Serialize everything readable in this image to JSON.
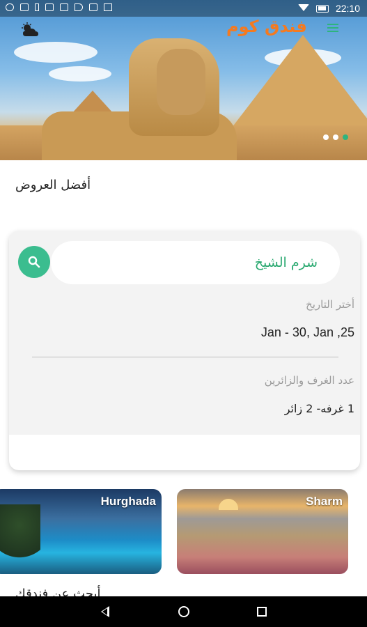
{
  "status_bar": {
    "time": "22:10"
  },
  "header": {
    "logo_text": "فندق كوم",
    "carousel_slides": 3,
    "active_slide": 3
  },
  "colors": {
    "brand_orange": "#f47a20",
    "accent_green": "#2eb47e",
    "search_button": "#3bbd8f"
  },
  "main": {
    "best_offers_title": "أفضل العروض",
    "search": {
      "destination_value": "شرم الشيخ",
      "date_label": "أختر التاريخ",
      "date_value": "Jan - 30, Jan ,25",
      "guests_label": "عدد الغرف والزائرين",
      "guests_value": "1 غرفه- 2 زائر"
    },
    "destinations": [
      {
        "label": "Hurghada"
      },
      {
        "label": "Sharm"
      }
    ],
    "partial_heading": "أبحث عن فندقك"
  },
  "icons": {
    "weather": "cloud-sun-icon",
    "menu": "menu-icon",
    "search": "search-icon",
    "nav_back": "back-icon",
    "nav_home": "home-icon",
    "nav_recent": "recent-apps-icon"
  }
}
